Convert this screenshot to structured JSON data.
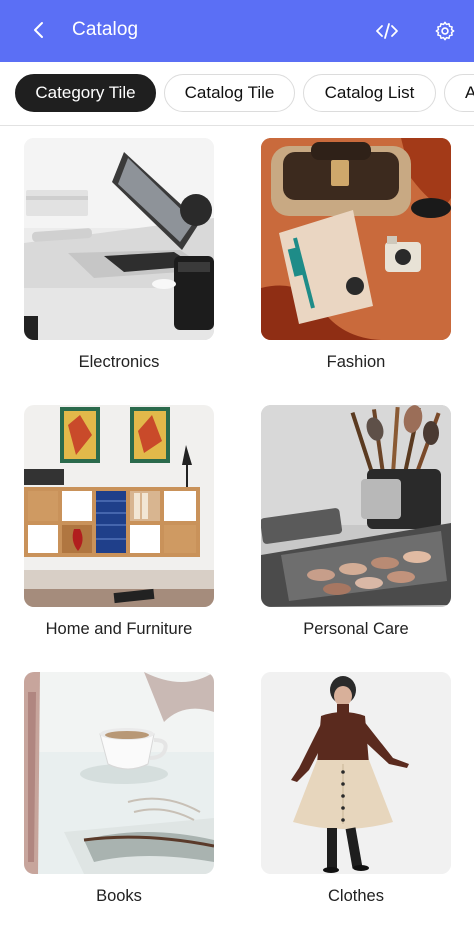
{
  "appbar": {
    "title": "Catalog",
    "back_icon": "arrow-left-icon",
    "code_icon": "code-icon",
    "settings_icon": "gear-icon",
    "color": "#5b6ff5"
  },
  "tabs": [
    {
      "label": "Category Tile",
      "active": true
    },
    {
      "label": "Catalog Tile",
      "active": false
    },
    {
      "label": "Catalog List",
      "active": false
    },
    {
      "label": "A",
      "active": false
    }
  ],
  "categories": [
    {
      "label": "Electronics"
    },
    {
      "label": "Fashion"
    },
    {
      "label": "Home and Furniture"
    },
    {
      "label": "Personal Care"
    },
    {
      "label": "Books"
    },
    {
      "label": "Clothes"
    }
  ]
}
